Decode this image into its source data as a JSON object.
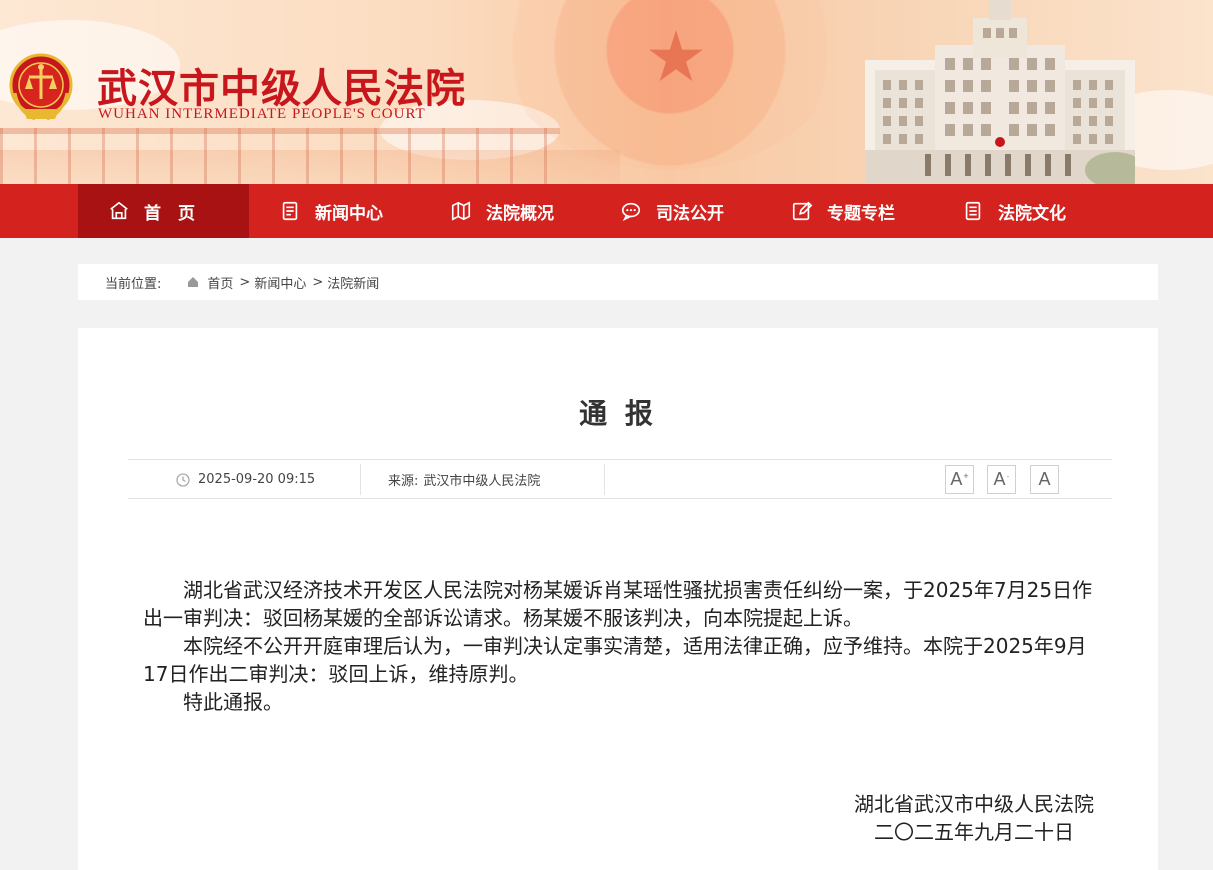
{
  "header": {
    "site_title": "武汉市中级人民法院",
    "site_subtitle": "WUHAN INTERMEDIATE PEOPLE'S COURT"
  },
  "nav": {
    "items": [
      {
        "label": "首　页",
        "icon": "home-icon",
        "active": true
      },
      {
        "label": "新闻中心",
        "icon": "document-icon"
      },
      {
        "label": "法院概况",
        "icon": "map-icon"
      },
      {
        "label": "司法公开",
        "icon": "chat-icon"
      },
      {
        "label": "专题专栏",
        "icon": "edit-icon"
      },
      {
        "label": "法院文化",
        "icon": "book-icon"
      }
    ]
  },
  "breadcrumb": {
    "prefix": "当前位置:",
    "items": [
      "首页",
      "新闻中心",
      "法院新闻"
    ],
    "separator": ">"
  },
  "article": {
    "title": "通 报",
    "datetime": "2025-09-20 09:15",
    "source_label": "来源:",
    "source": "武汉市中级人民法院",
    "font_buttons": [
      "A",
      "A",
      "A"
    ],
    "paragraphs": [
      "湖北省武汉经济技术开发区人民法院对杨某媛诉肖某瑶性骚扰损害责任纠纷一案，于2025年7月25日作出一审判决：驳回杨某媛的全部诉讼请求。杨某媛不服该判决，向本院提起上诉。",
      "本院经不公开开庭审理后认为，一审判决认定事实清楚，适用法律正确，应予维持。本院于2025年9月17日作出二审判决：驳回上诉，维持原判。",
      "特此通报。"
    ],
    "signature": "湖北省武汉市中级人民法院",
    "sign_date": "二〇二五年九月二十日"
  },
  "colors": {
    "brand_red": "#d4221f",
    "nav_active": "#a81212",
    "title_red": "#c8161d"
  }
}
